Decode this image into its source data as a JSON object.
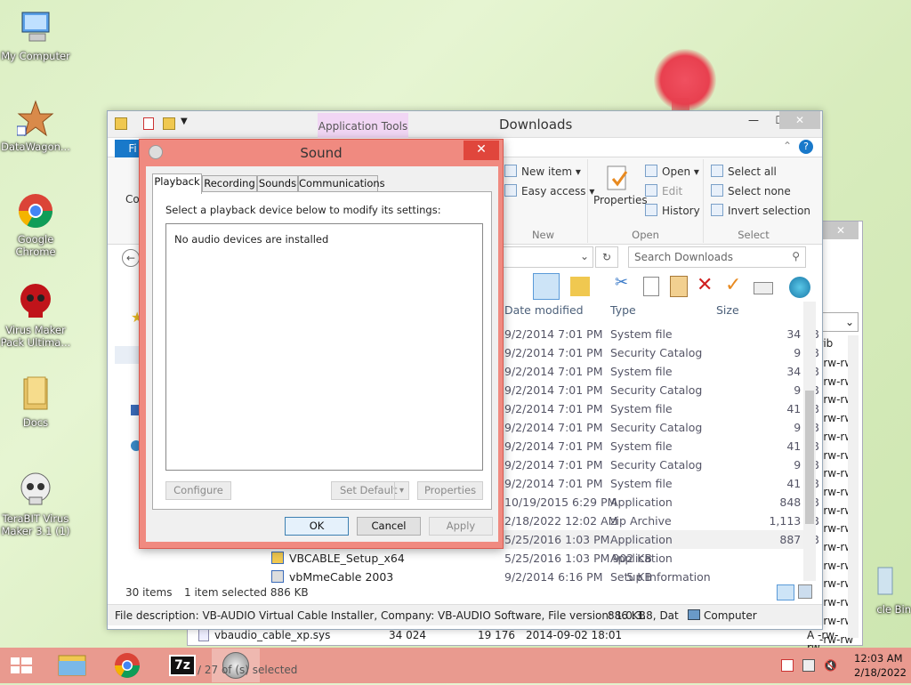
{
  "desktop": {
    "icons": [
      {
        "label": "My Computer"
      },
      {
        "label": "DataWagon..."
      },
      {
        "label": "Google Chrome"
      },
      {
        "label": "Virus Maker Pack Ultima..."
      },
      {
        "label": "Docs"
      },
      {
        "label": "TeraBIT Virus Maker 3.1 (1)"
      },
      {
        "label": "cle Bin"
      }
    ]
  },
  "explorer": {
    "title": "Downloads",
    "app_tools": "Application Tools",
    "file_tab": "Fi",
    "ribbon": {
      "copy_partial": "Co",
      "new_item": "New item",
      "easy_access": "Easy access",
      "new_group": "New",
      "properties": "Properties",
      "open": "Open",
      "edit": "Edit",
      "history": "History",
      "open_group": "Open",
      "select_all": "Select all",
      "select_none": "Select none",
      "invert_selection": "Invert selection",
      "select_group": "Select"
    },
    "search_placeholder": "Search Downloads",
    "columns": {
      "date": "Date modified",
      "type": "Type",
      "size": "Size"
    },
    "rows": [
      {
        "date": "9/2/2014 7:01 PM",
        "type": "System file",
        "size": "34 KB"
      },
      {
        "date": "9/2/2014 7:01 PM",
        "type": "Security Catalog",
        "size": "9 KB"
      },
      {
        "date": "9/2/2014 7:01 PM",
        "type": "System file",
        "size": "34 KB"
      },
      {
        "date": "9/2/2014 7:01 PM",
        "type": "Security Catalog",
        "size": "9 KB"
      },
      {
        "date": "9/2/2014 7:01 PM",
        "type": "System file",
        "size": "41 KB"
      },
      {
        "date": "9/2/2014 7:01 PM",
        "type": "Security Catalog",
        "size": "9 KB"
      },
      {
        "date": "9/2/2014 7:01 PM",
        "type": "System file",
        "size": "41 KB"
      },
      {
        "date": "9/2/2014 7:01 PM",
        "type": "Security Catalog",
        "size": "9 KB"
      },
      {
        "date": "9/2/2014 7:01 PM",
        "type": "System file",
        "size": "41 KB"
      },
      {
        "date": "10/19/2015 6:29 PM",
        "type": "Application",
        "size": "848 KB"
      },
      {
        "date": "2/18/2022 12:02 AM",
        "type": "zip Archive",
        "size": "1,113 KB"
      },
      {
        "date": "5/25/2016 1:03 PM",
        "type": "Application",
        "size": "887 KB"
      },
      {
        "name": "VBCABLE_Setup_x64",
        "date": "5/25/2016 1:03 PM",
        "type": "Application",
        "size": "902 KB"
      },
      {
        "name": "vbMmeCable 2003",
        "date": "9/2/2014 6:16 PM",
        "type": "Setup Information",
        "size": "5 KB"
      }
    ],
    "status_items": "30 items",
    "status_selected": "1 item selected  886 KB",
    "file_description": "File description: VB-AUDIO Virtual Cable Installer, Company: VB-AUDIO Software, File version: 1.0.3.8, Dat",
    "desc_size": "886 KB",
    "desc_location": "Computer"
  },
  "back_window": {
    "attr_header": "ttrib",
    "attr_rows": [
      "-rw-rw",
      "-rw-rw",
      "-rw-rw",
      "-rw-rw",
      "-rw-rw",
      "-rw-rw",
      "-rw-rw",
      "-rw-rw",
      "-rw-rw",
      "-rw-rw",
      "-rw-rw",
      "-rw-rw",
      "-rw-rw",
      "-rw-rw",
      "-rw-rw",
      "-rw-rw"
    ],
    "bottom_row": {
      "name": "vbaudio_cable_xp.sys",
      "c1": "34 024",
      "c2": "19 176",
      "date": "2014-09-02 18:01",
      "attr": "A -rw-rw"
    },
    "status": "/ 27 of      (s) selected"
  },
  "sound_dialog": {
    "title": "Sound",
    "tabs": [
      "Playback",
      "Recording",
      "Sounds",
      "Communications"
    ],
    "instruction": "Select a playback device below to modify its settings:",
    "empty_message": "No audio devices are installed",
    "configure": "Configure",
    "set_default": "Set Default",
    "properties": "Properties",
    "ok": "OK",
    "cancel": "Cancel",
    "apply": "Apply"
  },
  "taskbar": {
    "time": "12:03 AM",
    "date": "2/18/2022"
  },
  "colors": {
    "dialog_frame": "#f08a80",
    "taskbar": "#e99a8f",
    "file_tab": "#1979ca",
    "close_button": "#e0463c"
  }
}
